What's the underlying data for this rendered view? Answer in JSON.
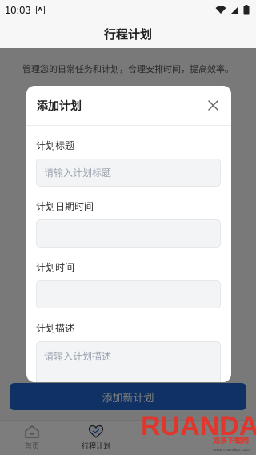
{
  "status_bar": {
    "time": "10:03",
    "notification_icon": "a-badge-icon",
    "signal_icons": [
      "wifi-icon",
      "cellular-icon",
      "battery-icon"
    ]
  },
  "header": {
    "title": "行程计划"
  },
  "main": {
    "intro": "管理您的日常任务和计划，合理安排时间，提高效率。",
    "add_button_label": "添加新计划"
  },
  "modal": {
    "title": "添加计划",
    "fields": [
      {
        "label": "计划标题",
        "value": "",
        "placeholder": "请输入计划标题"
      },
      {
        "label": "计划日期时间",
        "value": "",
        "placeholder": ""
      },
      {
        "label": "计划时间",
        "value": "",
        "placeholder": ""
      },
      {
        "label": "计划描述",
        "value": "",
        "placeholder": "请输入计划描述"
      }
    ]
  },
  "bottom_nav": {
    "items": [
      {
        "label": "首页",
        "icon": "home-icon",
        "active": false
      },
      {
        "label": "行程计划",
        "icon": "heart-icon",
        "active": true
      }
    ]
  },
  "watermark": {
    "brand": "RUANDAO",
    "tagline": "如多下载网",
    "url": "www.ruandao.com"
  },
  "colors": {
    "accent": "#1e63c6",
    "overlay": "rgba(0,0,0,0.5)",
    "input_bg": "#f3f4f6"
  }
}
